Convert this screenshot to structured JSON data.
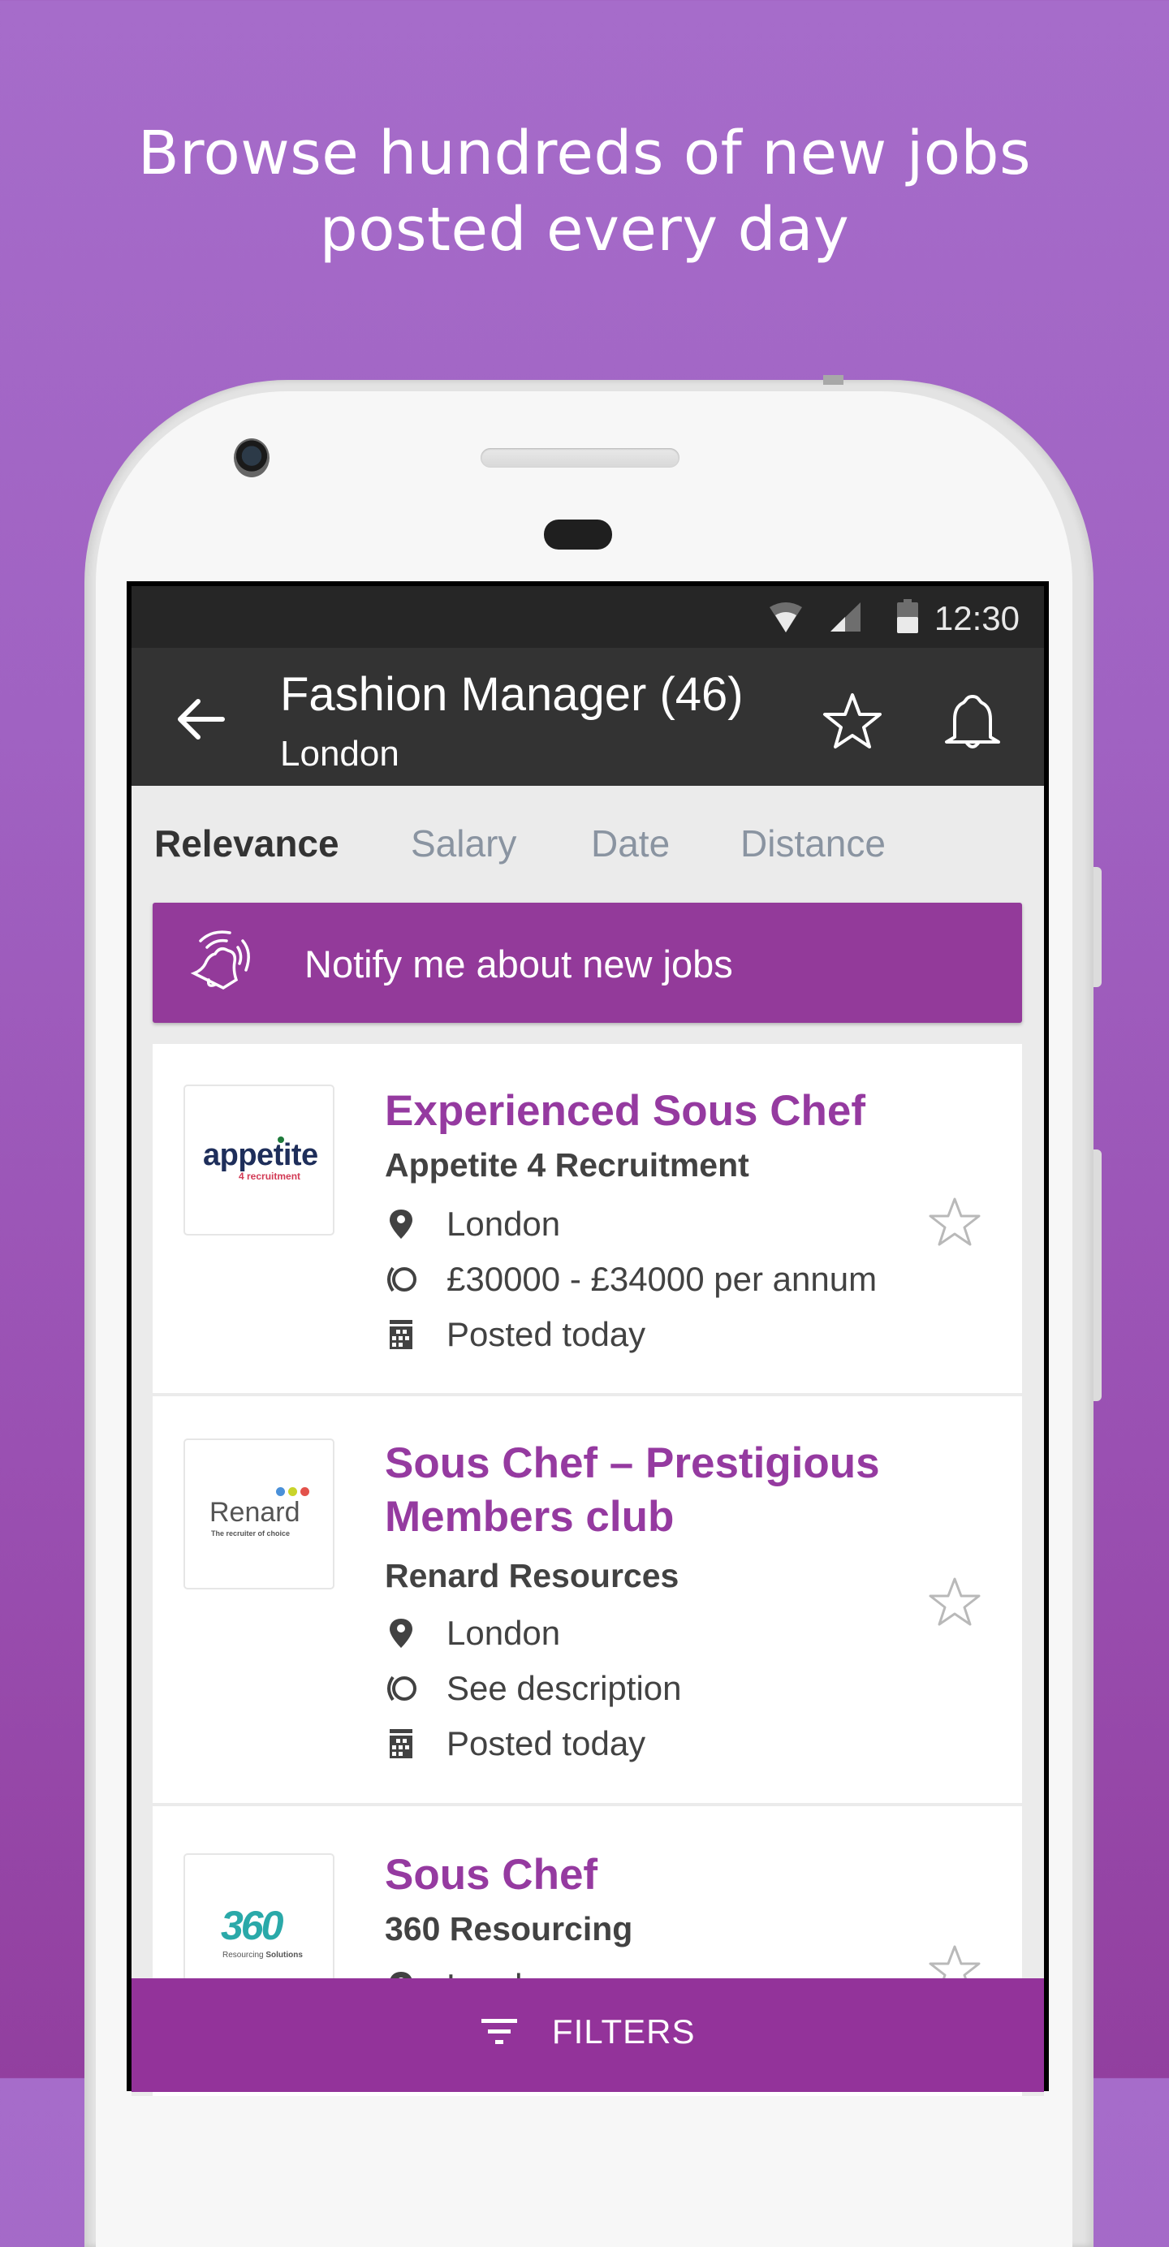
{
  "headline": {
    "line1": "Browse hundreds of new jobs",
    "line2": "posted every day"
  },
  "colors": {
    "brand_purple": "#933a9a",
    "job_title": "#953aa0",
    "appbar": "#333333",
    "statusbar": "#262626"
  },
  "status_bar": {
    "time": "12:30",
    "icons": [
      "wifi-icon",
      "cell-signal-icon",
      "battery-icon"
    ]
  },
  "app_bar": {
    "back_icon": "arrow-left-icon",
    "title": "Fashion Manager (46)",
    "subtitle": "London",
    "actions": [
      "star-icon",
      "bell-icon"
    ]
  },
  "sort_tabs": [
    {
      "label": "Relevance",
      "active": true
    },
    {
      "label": "Salary",
      "active": false
    },
    {
      "label": "Date",
      "active": false
    },
    {
      "label": "Distance",
      "active": false
    }
  ],
  "notify_banner": {
    "icon": "ringing-bell-icon",
    "label": "Notify me about new jobs"
  },
  "jobs": [
    {
      "title": "Experienced Sous Chef",
      "company": "Appetite 4 Recruitment",
      "logo": {
        "main": "appetite",
        "sub": "4 recruitment"
      },
      "location": "London",
      "salary": "£30000 - £34000 per annum",
      "posted": "Posted today",
      "saved": false
    },
    {
      "title": "Sous Chef – Prestigious Members club",
      "company": "Renard Resources",
      "logo": {
        "main": "Renard",
        "sub": "The recruiter of choice"
      },
      "location": "London",
      "salary": "See description",
      "posted": "Posted today",
      "saved": false
    },
    {
      "title": "Sous Chef",
      "company": "360 Resourcing",
      "logo": {
        "main": "360",
        "sub_light": "Resourcing",
        "sub_bold": "Solutions"
      },
      "location": "London",
      "saved": false
    }
  ],
  "filters_bar": {
    "icon": "filter-icon",
    "label": "FILTERS"
  }
}
